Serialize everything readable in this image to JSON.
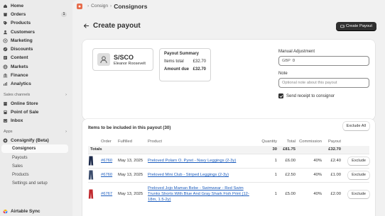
{
  "sidebar": {
    "primary": [
      {
        "label": "Home",
        "icon": "home-icon"
      },
      {
        "label": "Orders",
        "icon": "orders-icon",
        "badge": "1"
      },
      {
        "label": "Products",
        "icon": "tag-icon"
      },
      {
        "label": "Customers",
        "icon": "person-icon"
      },
      {
        "label": "Marketing",
        "icon": "target-icon"
      },
      {
        "label": "Discounts",
        "icon": "discount-icon"
      },
      {
        "label": "Content",
        "icon": "content-icon"
      },
      {
        "label": "Markets",
        "icon": "globe-icon"
      },
      {
        "label": "Finance",
        "icon": "bank-icon"
      },
      {
        "label": "Analytics",
        "icon": "chart-icon"
      }
    ],
    "sales_channels_label": "Sales channels",
    "sales_channels": [
      {
        "label": "Online Store",
        "icon": "store-icon"
      },
      {
        "label": "Point of Sale",
        "icon": "pos-icon"
      },
      {
        "label": "Inbox",
        "icon": "inbox-icon"
      }
    ],
    "apps_label": "Apps",
    "app_name": "Consignify (Beta)",
    "app_sub": [
      {
        "label": "Consignors",
        "active": true
      },
      {
        "label": "Payouts"
      },
      {
        "label": "Sales"
      },
      {
        "label": "Products"
      },
      {
        "label": "Settings and setup"
      }
    ],
    "bottom_app": "Airtable Sync"
  },
  "breadcrumb": {
    "parent": "Consign",
    "title": "Consignors"
  },
  "page": {
    "title": "Create payout",
    "create_button": "Create Payout"
  },
  "consignor": {
    "code": "S/SCO",
    "name": "Eleanor Roosevelt"
  },
  "summary": {
    "title": "Payout Summary",
    "items_total_label": "Items total",
    "items_total_value": "£32.70",
    "amount_due_label": "Amount due",
    "amount_due_value": "£32.70"
  },
  "form": {
    "adjustment_label": "Manual Adjustment",
    "adjustment_prefix": "GBP",
    "adjustment_value": "0",
    "note_label": "Note",
    "note_placeholder": "Optional note about this payout",
    "send_receipt_label": "Send receipt to consignor",
    "send_receipt_checked": true
  },
  "items": {
    "heading": "Items to be included in this payout (30)",
    "exclude_all": "Exclude All",
    "columns": [
      "",
      "Order",
      "Fulfilled",
      "Product",
      "Quantity",
      "Total",
      "Commission",
      "Payout",
      ""
    ],
    "totals": {
      "label": "Totals",
      "quantity": "30",
      "total": "£81.75",
      "payout": "£32.70"
    },
    "rows": [
      {
        "order": "#6760",
        "fulfilled": "May 13, 2025",
        "product": "Preloved Polarn O. Pyret - Navy Leggings (2-3y)",
        "quantity": "1",
        "total": "£6.00",
        "commission": "40%",
        "payout": "£2.40",
        "action": "Exclude",
        "thumb_color": "#1d2a4a"
      },
      {
        "order": "#6760",
        "fulfilled": "May 13, 2025",
        "product": "Preloved Mini Club - Striped Leggings (2-3y)",
        "quantity": "1",
        "total": "£2.50",
        "commission": "40%",
        "payout": "£1.00",
        "action": "Exclude",
        "thumb_color": "#3a4b6b"
      },
      {
        "order": "#6767",
        "fulfilled": "May 13, 2025",
        "product": "Preloved Jojo Maman Bebe - Swimwear - Red Swim Trunks Shorts With Blue And Gray Shark Fish Print (12-18m, 1.5-2y)",
        "quantity": "1",
        "total": "£5.00",
        "commission": "40%",
        "payout": "£2.00",
        "action": "Exclude",
        "thumb_color": "#c0282d"
      }
    ]
  }
}
